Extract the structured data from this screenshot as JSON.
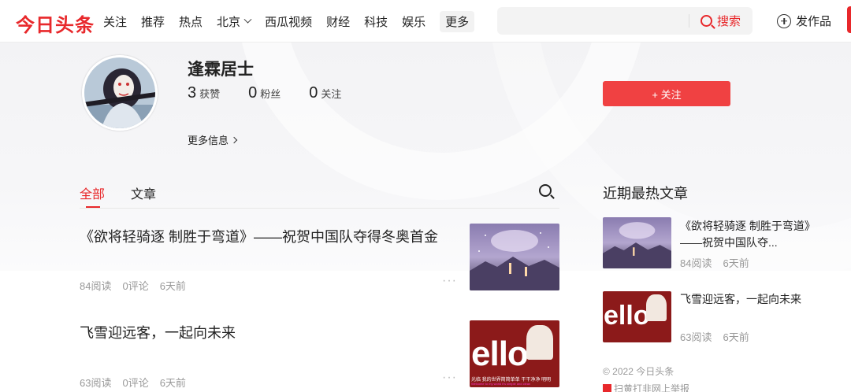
{
  "header": {
    "logo": "今日头条",
    "nav": [
      "关注",
      "推荐",
      "热点",
      "北京",
      "西瓜视频",
      "财经",
      "科技",
      "娱乐"
    ],
    "nav_more": "更多",
    "search_placeholder": "",
    "search_label": "搜索",
    "publish_label": "发作品"
  },
  "profile": {
    "name": "逢霖居士",
    "stats": [
      {
        "num": "3",
        "label": "获赞"
      },
      {
        "num": "0",
        "label": "粉丝"
      },
      {
        "num": "0",
        "label": "关注"
      }
    ],
    "more_info": "更多信息",
    "follow_label": "+ 关注"
  },
  "tabs": [
    "全部",
    "文章"
  ],
  "articles": [
    {
      "title": "《欲将轻骑逐 制胜于弯道》——祝贺中国队夺得冬奥首金",
      "reads": "84阅读",
      "comments": "0评论",
      "time": "6天前"
    },
    {
      "title": "飞雪迎远客，一起向未来",
      "reads": "63阅读",
      "comments": "0评论",
      "time": "6天前"
    }
  ],
  "sidebar": {
    "title": "近期最热文章",
    "items": [
      {
        "title": "《欲将轻骑逐 制胜于弯道》——祝贺中国队夺...",
        "reads": "84阅读",
        "time": "6天前"
      },
      {
        "title": "飞雪迎远客，一起向未来",
        "reads": "63阅读",
        "time": "6天前"
      }
    ],
    "copyright": "© 2022 今日头条",
    "report": "扫黄打非网上举报"
  },
  "thumb_text": {
    "hello_word": "ello",
    "hello_caption": "光临 我的世界简简单单 干干净净 明明",
    "hello_sub": "Welcome to my world it's simple and clean"
  },
  "colors": {
    "brand": "#e8282b",
    "follow": "#f04142"
  }
}
